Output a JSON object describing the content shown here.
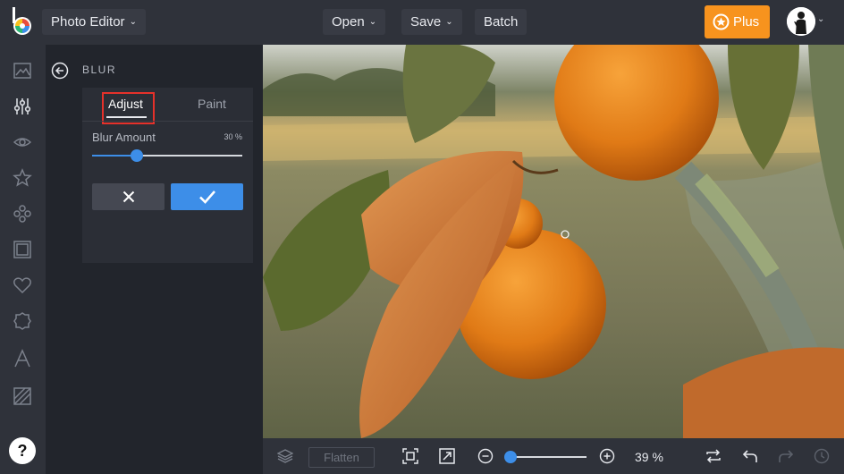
{
  "header": {
    "app_menu_label": "Photo Editor",
    "open_label": "Open",
    "save_label": "Save",
    "batch_label": "Batch",
    "plus_label": "Plus"
  },
  "sidebar": {
    "items": [
      {
        "name": "image-icon"
      },
      {
        "name": "adjust-sliders-icon"
      },
      {
        "name": "eye-icon"
      },
      {
        "name": "star-icon"
      },
      {
        "name": "flower-icon"
      },
      {
        "name": "frame-icon"
      },
      {
        "name": "heart-icon"
      },
      {
        "name": "badge-icon"
      },
      {
        "name": "text-icon"
      },
      {
        "name": "texture-icon"
      }
    ],
    "help_label": "?"
  },
  "panel": {
    "title": "BLUR",
    "tabs": {
      "adjust": "Adjust",
      "paint": "Paint"
    },
    "blur_label": "Blur Amount",
    "blur_value_text": "30 %",
    "blur_value": 0.3
  },
  "bottombar": {
    "flatten_label": "Flatten",
    "zoom_text": "39 %",
    "zoom_value": 0.05
  },
  "colors": {
    "accent": "#3d8ee8",
    "plus": "#f7931e",
    "highlight": "#e5312a"
  }
}
